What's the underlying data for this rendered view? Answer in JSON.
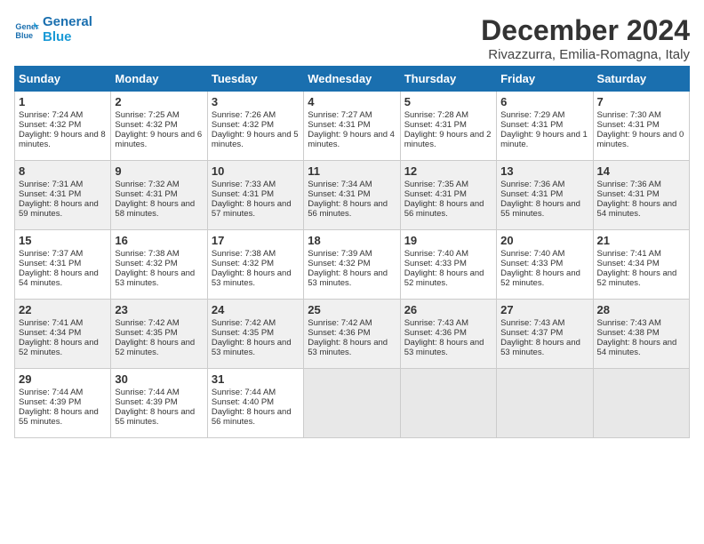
{
  "header": {
    "logo_line1": "General",
    "logo_line2": "Blue",
    "title": "December 2024",
    "subtitle": "Rivazzurra, Emilia-Romagna, Italy"
  },
  "weekdays": [
    "Sunday",
    "Monday",
    "Tuesday",
    "Wednesday",
    "Thursday",
    "Friday",
    "Saturday"
  ],
  "weeks": [
    [
      {
        "day": "1",
        "sunrise": "Sunrise: 7:24 AM",
        "sunset": "Sunset: 4:32 PM",
        "daylight": "Daylight: 9 hours and 8 minutes."
      },
      {
        "day": "2",
        "sunrise": "Sunrise: 7:25 AM",
        "sunset": "Sunset: 4:32 PM",
        "daylight": "Daylight: 9 hours and 6 minutes."
      },
      {
        "day": "3",
        "sunrise": "Sunrise: 7:26 AM",
        "sunset": "Sunset: 4:32 PM",
        "daylight": "Daylight: 9 hours and 5 minutes."
      },
      {
        "day": "4",
        "sunrise": "Sunrise: 7:27 AM",
        "sunset": "Sunset: 4:31 PM",
        "daylight": "Daylight: 9 hours and 4 minutes."
      },
      {
        "day": "5",
        "sunrise": "Sunrise: 7:28 AM",
        "sunset": "Sunset: 4:31 PM",
        "daylight": "Daylight: 9 hours and 2 minutes."
      },
      {
        "day": "6",
        "sunrise": "Sunrise: 7:29 AM",
        "sunset": "Sunset: 4:31 PM",
        "daylight": "Daylight: 9 hours and 1 minute."
      },
      {
        "day": "7",
        "sunrise": "Sunrise: 7:30 AM",
        "sunset": "Sunset: 4:31 PM",
        "daylight": "Daylight: 9 hours and 0 minutes."
      }
    ],
    [
      {
        "day": "8",
        "sunrise": "Sunrise: 7:31 AM",
        "sunset": "Sunset: 4:31 PM",
        "daylight": "Daylight: 8 hours and 59 minutes."
      },
      {
        "day": "9",
        "sunrise": "Sunrise: 7:32 AM",
        "sunset": "Sunset: 4:31 PM",
        "daylight": "Daylight: 8 hours and 58 minutes."
      },
      {
        "day": "10",
        "sunrise": "Sunrise: 7:33 AM",
        "sunset": "Sunset: 4:31 PM",
        "daylight": "Daylight: 8 hours and 57 minutes."
      },
      {
        "day": "11",
        "sunrise": "Sunrise: 7:34 AM",
        "sunset": "Sunset: 4:31 PM",
        "daylight": "Daylight: 8 hours and 56 minutes."
      },
      {
        "day": "12",
        "sunrise": "Sunrise: 7:35 AM",
        "sunset": "Sunset: 4:31 PM",
        "daylight": "Daylight: 8 hours and 56 minutes."
      },
      {
        "day": "13",
        "sunrise": "Sunrise: 7:36 AM",
        "sunset": "Sunset: 4:31 PM",
        "daylight": "Daylight: 8 hours and 55 minutes."
      },
      {
        "day": "14",
        "sunrise": "Sunrise: 7:36 AM",
        "sunset": "Sunset: 4:31 PM",
        "daylight": "Daylight: 8 hours and 54 minutes."
      }
    ],
    [
      {
        "day": "15",
        "sunrise": "Sunrise: 7:37 AM",
        "sunset": "Sunset: 4:31 PM",
        "daylight": "Daylight: 8 hours and 54 minutes."
      },
      {
        "day": "16",
        "sunrise": "Sunrise: 7:38 AM",
        "sunset": "Sunset: 4:32 PM",
        "daylight": "Daylight: 8 hours and 53 minutes."
      },
      {
        "day": "17",
        "sunrise": "Sunrise: 7:38 AM",
        "sunset": "Sunset: 4:32 PM",
        "daylight": "Daylight: 8 hours and 53 minutes."
      },
      {
        "day": "18",
        "sunrise": "Sunrise: 7:39 AM",
        "sunset": "Sunset: 4:32 PM",
        "daylight": "Daylight: 8 hours and 53 minutes."
      },
      {
        "day": "19",
        "sunrise": "Sunrise: 7:40 AM",
        "sunset": "Sunset: 4:33 PM",
        "daylight": "Daylight: 8 hours and 52 minutes."
      },
      {
        "day": "20",
        "sunrise": "Sunrise: 7:40 AM",
        "sunset": "Sunset: 4:33 PM",
        "daylight": "Daylight: 8 hours and 52 minutes."
      },
      {
        "day": "21",
        "sunrise": "Sunrise: 7:41 AM",
        "sunset": "Sunset: 4:34 PM",
        "daylight": "Daylight: 8 hours and 52 minutes."
      }
    ],
    [
      {
        "day": "22",
        "sunrise": "Sunrise: 7:41 AM",
        "sunset": "Sunset: 4:34 PM",
        "daylight": "Daylight: 8 hours and 52 minutes."
      },
      {
        "day": "23",
        "sunrise": "Sunrise: 7:42 AM",
        "sunset": "Sunset: 4:35 PM",
        "daylight": "Daylight: 8 hours and 52 minutes."
      },
      {
        "day": "24",
        "sunrise": "Sunrise: 7:42 AM",
        "sunset": "Sunset: 4:35 PM",
        "daylight": "Daylight: 8 hours and 53 minutes."
      },
      {
        "day": "25",
        "sunrise": "Sunrise: 7:42 AM",
        "sunset": "Sunset: 4:36 PM",
        "daylight": "Daylight: 8 hours and 53 minutes."
      },
      {
        "day": "26",
        "sunrise": "Sunrise: 7:43 AM",
        "sunset": "Sunset: 4:36 PM",
        "daylight": "Daylight: 8 hours and 53 minutes."
      },
      {
        "day": "27",
        "sunrise": "Sunrise: 7:43 AM",
        "sunset": "Sunset: 4:37 PM",
        "daylight": "Daylight: 8 hours and 53 minutes."
      },
      {
        "day": "28",
        "sunrise": "Sunrise: 7:43 AM",
        "sunset": "Sunset: 4:38 PM",
        "daylight": "Daylight: 8 hours and 54 minutes."
      }
    ],
    [
      {
        "day": "29",
        "sunrise": "Sunrise: 7:44 AM",
        "sunset": "Sunset: 4:39 PM",
        "daylight": "Daylight: 8 hours and 55 minutes."
      },
      {
        "day": "30",
        "sunrise": "Sunrise: 7:44 AM",
        "sunset": "Sunset: 4:39 PM",
        "daylight": "Daylight: 8 hours and 55 minutes."
      },
      {
        "day": "31",
        "sunrise": "Sunrise: 7:44 AM",
        "sunset": "Sunset: 4:40 PM",
        "daylight": "Daylight: 8 hours and 56 minutes."
      },
      null,
      null,
      null,
      null
    ]
  ]
}
